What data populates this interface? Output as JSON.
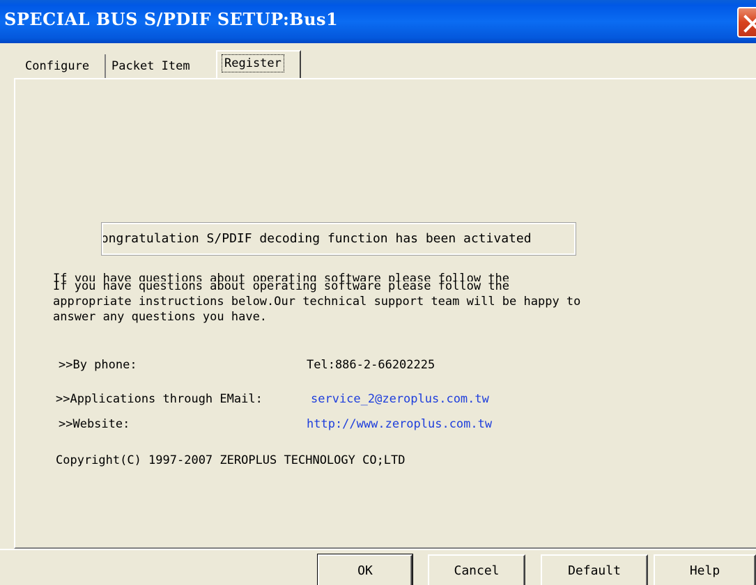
{
  "window": {
    "title": "SPECIAL BUS S/PDIF SETUP:Bus1"
  },
  "tabs": [
    {
      "label": "Configure",
      "active": false
    },
    {
      "label": "Packet Item",
      "active": false
    },
    {
      "label": "Register",
      "active": true
    }
  ],
  "register": {
    "status_message": "Congratulation S/PDIF decoding function has been activated",
    "clipped_line": "If you have questions about operating software please follow the",
    "support_text_line1": "If you have questions about operating software please follow the",
    "support_text_line2": "appropriate instructions below.Our technical support team will be happy to",
    "support_text_line3": "answer any questions you have.",
    "phone_label": ">>By phone:",
    "phone_value": "Tel:886-2-66202225",
    "email_label": ">>Applications through EMail:",
    "email_value": "service_2@zeroplus.com.tw",
    "website_label": ">>Website:",
    "website_value": "http://www.zeroplus.com.tw",
    "copyright": "Copyright(C) 1997-2007 ZEROPLUS TECHNOLOGY CO;LTD"
  },
  "buttons": {
    "ok": "OK",
    "cancel": "Cancel",
    "default": "Default",
    "help": "Help"
  },
  "colors": {
    "titlebar": "#0058E6",
    "dialog_bg": "#ECE9D8",
    "link": "#1E3EDC",
    "close_button": "#D8431E"
  },
  "icons": {
    "close": "close-icon"
  }
}
